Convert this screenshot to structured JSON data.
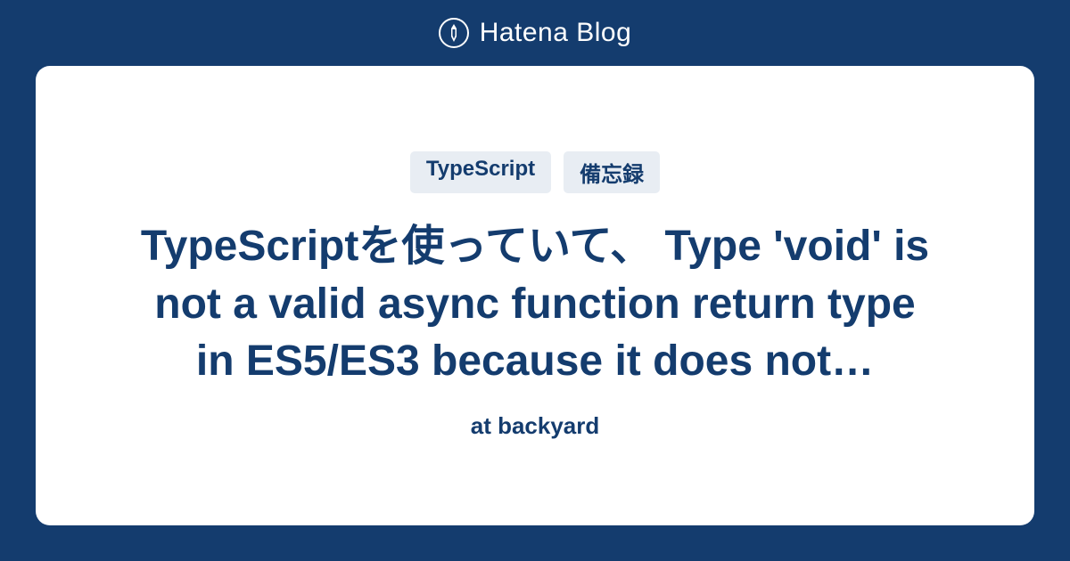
{
  "brand": {
    "name": "Hatena Blog"
  },
  "card": {
    "tags": [
      "TypeScript",
      "備忘録"
    ],
    "title": "TypeScriptを使っていて、 Type 'void' is not a valid async function return type in ES5/ES3 because it does not…",
    "subtitle": "at backyard"
  }
}
